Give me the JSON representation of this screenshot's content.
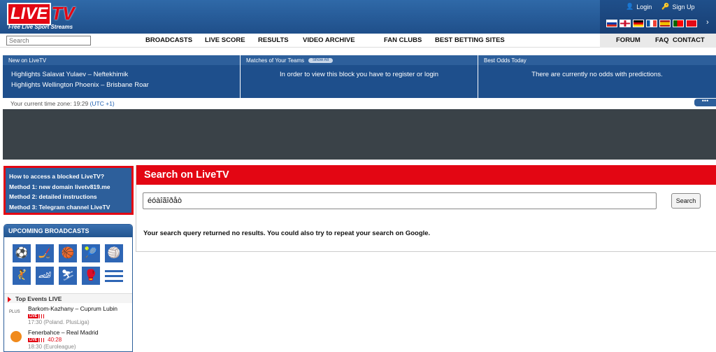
{
  "brand": {
    "live": "LIVE",
    "tv": "TV",
    "tagline": "Free Live Sport Streams"
  },
  "userlinks": {
    "login": "Login",
    "signup": "Sign Up"
  },
  "search": {
    "placeholder": "Search"
  },
  "nav": {
    "items": [
      "BROADCASTS",
      "LIVE SCORE",
      "RESULTS",
      "VIDEO ARCHIVE",
      "FAN CLUBS",
      "BEST BETTING SITES"
    ],
    "right": [
      "FORUM",
      "FAQ",
      "CONTACT"
    ]
  },
  "flags": {
    "colors": [
      "#d52b1e",
      "#c8102e",
      "#ffce00",
      "#0055a4",
      "#aa151b",
      "#006600",
      "#e30a17"
    ]
  },
  "infobar": {
    "new": {
      "title": "New on LiveTV",
      "items": [
        "Highlights Salavat Yulaev – Neftekhimik",
        "Highlights Wellington Phoenix – Brisbane Roar"
      ]
    },
    "teams": {
      "title": "Matches of Your Teams",
      "show_all": "Show All",
      "message": "In order to view this block you have to register or login"
    },
    "odds": {
      "title": "Best Odds Today",
      "message": "There are currently no odds with predictions."
    }
  },
  "timezone": {
    "text": "Your current time zone: 19:29",
    "utc": "(UTC +1)"
  },
  "blocked": {
    "title": "How to access a blocked LiveTV?",
    "methods": [
      "Method 1: new domain livetv819.me",
      "Method 2: detailed instructions",
      "Method 3: Telegram channel LiveTV"
    ]
  },
  "sidebar": {
    "title": "UPCOMING BROADCASTS",
    "top_events_label": "Top Events LIVE",
    "events": [
      {
        "title": "Barkom-Kazhany – Cuprum Lubin",
        "live": "LIVE",
        "time": "",
        "meta": "17:30 (Poland. PlusLiga)"
      },
      {
        "title": "Fenerbahce – Real Madrid",
        "live": "LIVE",
        "time": "40:28",
        "meta": "18:30 (Euroleague)"
      }
    ]
  },
  "main": {
    "title": "Search on LiveTV",
    "query": "éóàîãîðåò",
    "button": "Search",
    "no_results": "Your search query returned no results. You could also try to repeat your search on Google."
  }
}
